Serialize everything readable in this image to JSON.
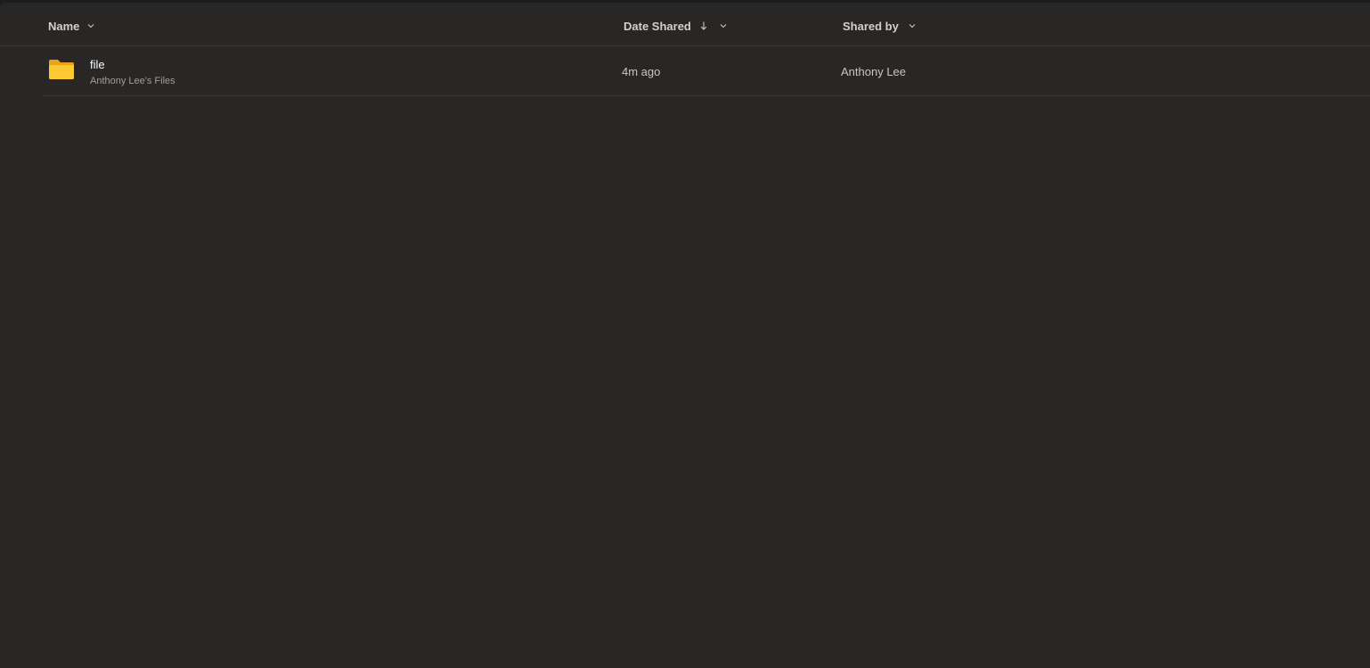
{
  "columns": {
    "name": "Name",
    "date_shared": "Date Shared",
    "shared_by": "Shared by"
  },
  "rows": [
    {
      "icon": "folder-icon",
      "name": "file",
      "location": "Anthony Lee's Files",
      "date_shared": "4m ago",
      "shared_by": "Anthony Lee"
    }
  ],
  "colors": {
    "background": "#282725",
    "folder": "#f8c22f",
    "divider": "#3a3937"
  }
}
